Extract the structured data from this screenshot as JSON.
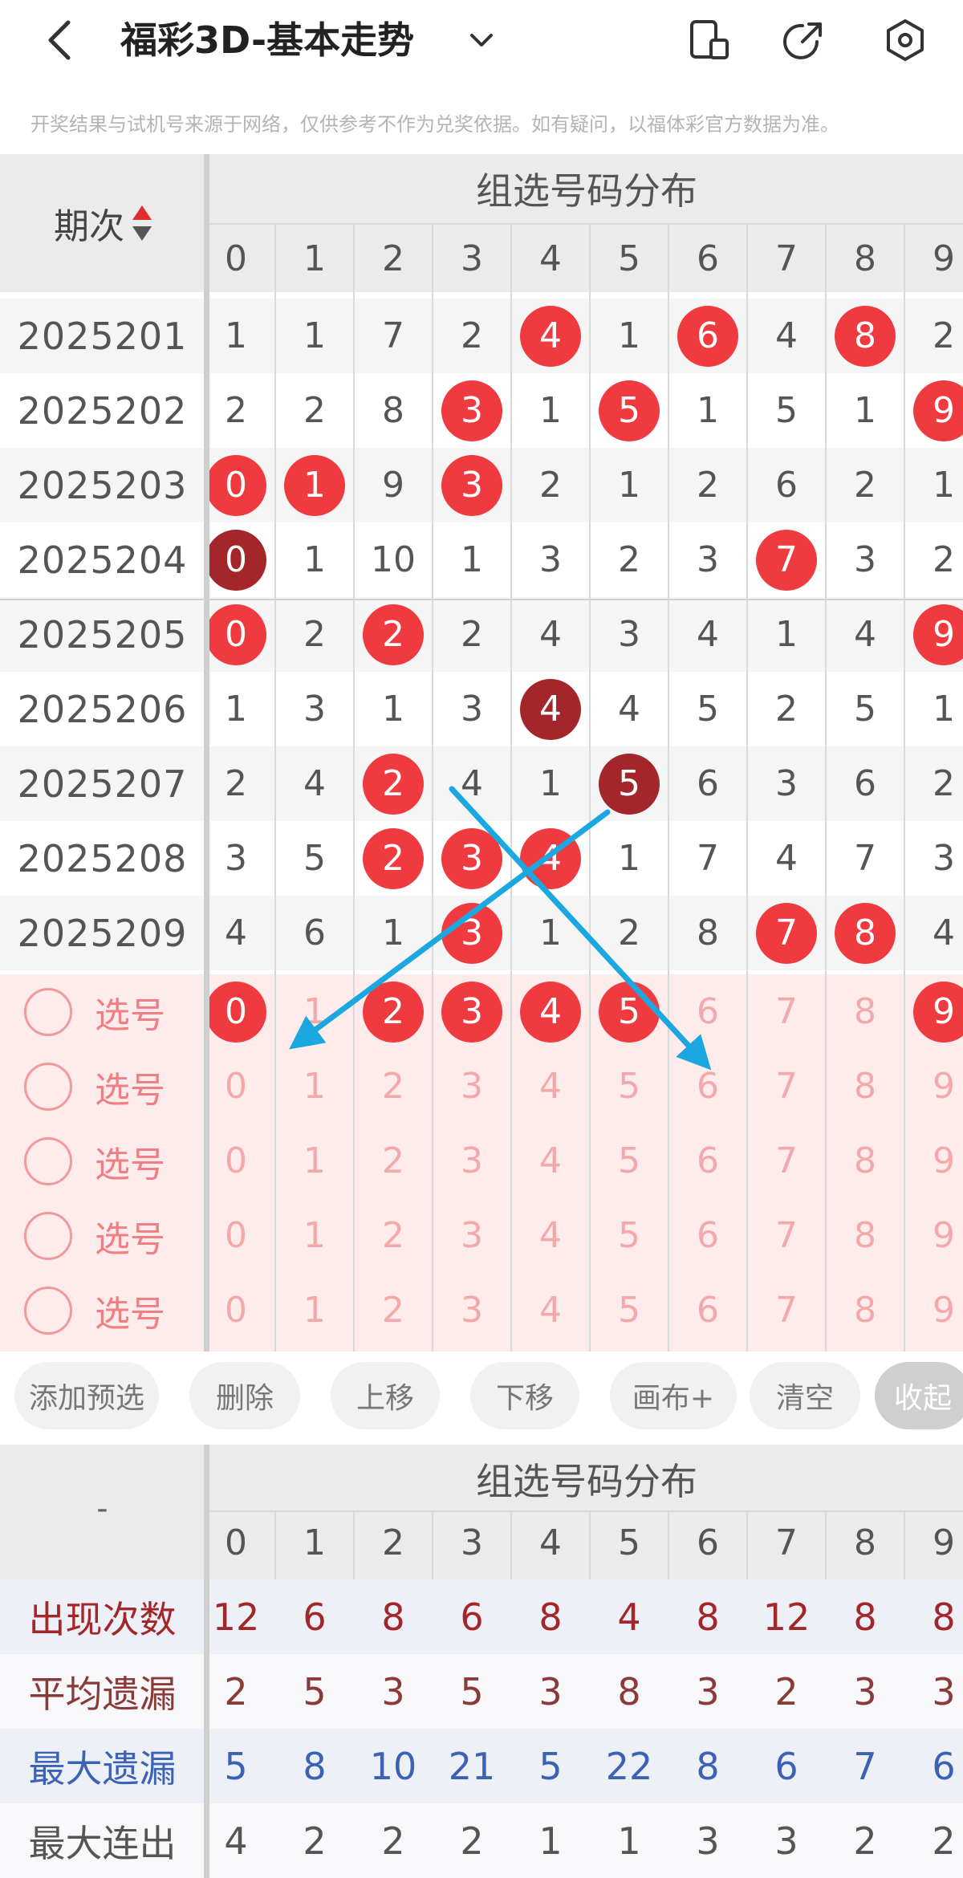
{
  "header": {
    "title": "福彩3D-基本走势",
    "notice": "开奖结果与试机号来源于网络，仅供参考不作为兑奖依据。如有疑问，以福体彩官方数据为准。"
  },
  "table": {
    "period_header": "期次",
    "group_title": "组选号码分布",
    "digits": [
      "0",
      "1",
      "2",
      "3",
      "4",
      "5",
      "6",
      "7",
      "8",
      "9"
    ],
    "rows": [
      {
        "period": "2025201",
        "cells": [
          {
            "v": "1"
          },
          {
            "v": "1"
          },
          {
            "v": "7"
          },
          {
            "v": "2"
          },
          {
            "v": "4",
            "ball": "red"
          },
          {
            "v": "1"
          },
          {
            "v": "6",
            "ball": "red"
          },
          {
            "v": "4"
          },
          {
            "v": "8",
            "ball": "red"
          },
          {
            "v": "2"
          }
        ]
      },
      {
        "period": "2025202",
        "cells": [
          {
            "v": "2"
          },
          {
            "v": "2"
          },
          {
            "v": "8"
          },
          {
            "v": "3",
            "ball": "red"
          },
          {
            "v": "1"
          },
          {
            "v": "5",
            "ball": "red"
          },
          {
            "v": "1"
          },
          {
            "v": "5"
          },
          {
            "v": "1"
          },
          {
            "v": "9",
            "ball": "red"
          }
        ]
      },
      {
        "period": "2025203",
        "cells": [
          {
            "v": "0",
            "ball": "red"
          },
          {
            "v": "1",
            "ball": "red"
          },
          {
            "v": "9"
          },
          {
            "v": "3",
            "ball": "red"
          },
          {
            "v": "2"
          },
          {
            "v": "1"
          },
          {
            "v": "2"
          },
          {
            "v": "6"
          },
          {
            "v": "2"
          },
          {
            "v": "1"
          }
        ]
      },
      {
        "period": "2025204",
        "cells": [
          {
            "v": "0",
            "ball": "dark"
          },
          {
            "v": "1"
          },
          {
            "v": "10"
          },
          {
            "v": "1"
          },
          {
            "v": "3"
          },
          {
            "v": "2"
          },
          {
            "v": "3"
          },
          {
            "v": "7",
            "ball": "red"
          },
          {
            "v": "3"
          },
          {
            "v": "2"
          }
        ]
      },
      {
        "period": "2025205",
        "cells": [
          {
            "v": "0",
            "ball": "red"
          },
          {
            "v": "2"
          },
          {
            "v": "2",
            "ball": "red"
          },
          {
            "v": "2"
          },
          {
            "v": "4"
          },
          {
            "v": "3"
          },
          {
            "v": "4"
          },
          {
            "v": "1"
          },
          {
            "v": "4"
          },
          {
            "v": "9",
            "ball": "red"
          }
        ]
      },
      {
        "period": "2025206",
        "cells": [
          {
            "v": "1"
          },
          {
            "v": "3"
          },
          {
            "v": "1"
          },
          {
            "v": "3"
          },
          {
            "v": "4",
            "ball": "dark"
          },
          {
            "v": "4"
          },
          {
            "v": "5"
          },
          {
            "v": "2"
          },
          {
            "v": "5"
          },
          {
            "v": "1"
          }
        ]
      },
      {
        "period": "2025207",
        "cells": [
          {
            "v": "2"
          },
          {
            "v": "4"
          },
          {
            "v": "2",
            "ball": "red"
          },
          {
            "v": "4"
          },
          {
            "v": "1"
          },
          {
            "v": "5",
            "ball": "dark"
          },
          {
            "v": "6"
          },
          {
            "v": "3"
          },
          {
            "v": "6"
          },
          {
            "v": "2"
          }
        ]
      },
      {
        "period": "2025208",
        "cells": [
          {
            "v": "3"
          },
          {
            "v": "5"
          },
          {
            "v": "2",
            "ball": "red"
          },
          {
            "v": "3",
            "ball": "red"
          },
          {
            "v": "4",
            "ball": "red"
          },
          {
            "v": "1"
          },
          {
            "v": "7"
          },
          {
            "v": "4"
          },
          {
            "v": "7"
          },
          {
            "v": "3"
          }
        ]
      },
      {
        "period": "2025209",
        "cells": [
          {
            "v": "4"
          },
          {
            "v": "6"
          },
          {
            "v": "1"
          },
          {
            "v": "3",
            "ball": "red"
          },
          {
            "v": "1"
          },
          {
            "v": "2"
          },
          {
            "v": "8"
          },
          {
            "v": "7",
            "ball": "red"
          },
          {
            "v": "8",
            "ball": "red"
          },
          {
            "v": "4"
          }
        ]
      }
    ]
  },
  "picks": {
    "label": "选号",
    "selected_first_row": [
      "0",
      "2",
      "3",
      "4",
      "5",
      "9"
    ]
  },
  "toolbar": {
    "buttons": [
      "添加预选",
      "删除",
      "上移",
      "下移",
      "画布+",
      "清空",
      "收起"
    ]
  },
  "stats": {
    "corner": "-",
    "group_title": "组选号码分布",
    "rows": [
      {
        "label": "出现次数",
        "color": "#a3262b",
        "values": [
          "12",
          "6",
          "8",
          "6",
          "8",
          "4",
          "8",
          "12",
          "8",
          "8"
        ]
      },
      {
        "label": "平均遗漏",
        "color": "#8b3a3a",
        "values": [
          "2",
          "5",
          "3",
          "5",
          "3",
          "8",
          "3",
          "2",
          "3",
          "3"
        ]
      },
      {
        "label": "最大遗漏",
        "color": "#3b62b5",
        "values": [
          "5",
          "8",
          "10",
          "21",
          "5",
          "22",
          "8",
          "6",
          "7",
          "6"
        ]
      },
      {
        "label": "最大连出",
        "color": "#555555",
        "values": [
          "4",
          "2",
          "2",
          "2",
          "1",
          "1",
          "3",
          "3",
          "2",
          "2"
        ]
      }
    ]
  },
  "colors": {
    "ball_red": "#ef3b3f",
    "ball_dark": "#a3262b",
    "arrow": "#1ba8e0"
  }
}
